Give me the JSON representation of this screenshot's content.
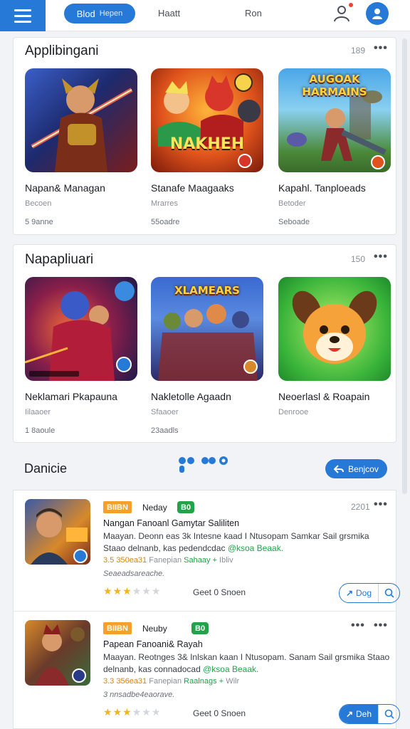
{
  "header": {
    "pill_label": "Blod",
    "pill_sub": "Hepen",
    "nav": [
      "Haatt",
      "Ron"
    ]
  },
  "sections": [
    {
      "title": "Applibingani",
      "count": "189",
      "tiles": [
        {
          "name": "Napan& Managan",
          "sub": "Becoen",
          "size": "5 9anne",
          "art_title": "",
          "icon": "warrior-art-icon"
        },
        {
          "name": "Stanafe Maagaaks",
          "sub": "Mrarres",
          "size": "55oadre",
          "art_title": "NAKHEH",
          "icon": "heroes-art-icon"
        },
        {
          "name": "Kapahl. Tanploeads",
          "sub": "Betoder",
          "size": "Seboade",
          "art_title": "AUGOAK HARMAINS",
          "icon": "battle-art-icon"
        }
      ]
    },
    {
      "title": "Napapliuari",
      "count": "150",
      "tiles": [
        {
          "name": "Neklamari Pkapauna",
          "sub": "Iilaaoer",
          "size": "1 8aoule",
          "art_title": "",
          "icon": "robot-hero-art-icon"
        },
        {
          "name": "Nakletolle Agaadn",
          "sub": "Sfaaoer",
          "size": "23aadls",
          "art_title": "XLAMEARS",
          "icon": "team-art-icon"
        },
        {
          "name": "Neoerlasl & Roapain",
          "sub": "Denrooe",
          "size": "",
          "art_title": "",
          "icon": "puppy-mascot-icon"
        }
      ]
    }
  ],
  "section3": {
    "title": "Danicie",
    "button": "Benjcov"
  },
  "items": [
    {
      "tag1": "BIIBN",
      "label": "Neday",
      "tag2": "B0",
      "count": "2201",
      "title": "Nangan Fanoanl Gamytar Saliliten",
      "desc_a": "Maayan. Deonn eas 3k Intesne kaad I Ntusopam Samkar Sail grsmika Staao delnanb, kas pedendcdac ",
      "desc_hl": "@ksoa Beaak.",
      "meta1": "3.5 350ea31",
      "meta2": "Fanepian",
      "meta3": "Sahaay +",
      "meta4": "Ibliv",
      "author": "Seaeadsareache.",
      "rating": 3,
      "rating_text": "Geet 0 Snoen",
      "btn_label": "Dog",
      "btn_filled": false
    },
    {
      "tag1": "BIIBN",
      "label": "Neuby",
      "tag2": "B0",
      "count": "",
      "title": "Papean Fanoani& Rayah",
      "desc_a": "Maayan. Reotnges 3& Inlskan kaan I Ntusopam. Sanam Sail grsmika Staao delnanb, kas connadocad ",
      "desc_hl": "@ksoa Beaak.",
      "meta1": "3.3 356ea31",
      "meta2": "Fanepian",
      "meta3": "Raalnags +",
      "meta4": "Wilr",
      "author": "3 nnsadbe4eaorave.",
      "rating": 3,
      "rating_text": "Geet 0 Snoen",
      "btn_label": "Deh",
      "btn_filled": true
    }
  ],
  "colors": {
    "accent": "#2779d8",
    "star": "#f2b41a",
    "green": "#22a34a",
    "orange": "#f3a12a"
  }
}
